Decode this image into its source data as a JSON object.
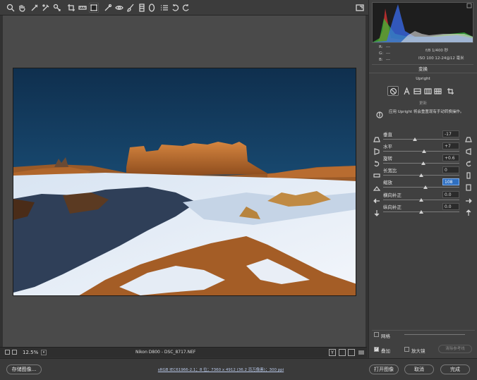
{
  "toolbar": {
    "tools": [
      "zoom-tool",
      "hand-tool",
      "white-balance-tool",
      "color-sampler-tool",
      "targeted-adjustment-tool",
      "crop-tool",
      "straighten-tool",
      "transform-tool",
      "spot-removal-tool",
      "red-eye-tool",
      "adjustment-brush-tool",
      "graduated-filter-tool",
      "radial-filter-tool",
      "preferences",
      "rotate-ccw",
      "rotate-cw"
    ],
    "fullscreen": "fullscreen-toggle"
  },
  "photo": {
    "filename": "DSC_8717.NEF"
  },
  "status": {
    "zoom": "12.5%",
    "camera_file": "Nikon D800 - DSC_8717.NEF",
    "view_modes": [
      "Y"
    ]
  },
  "footer": {
    "save_label": "存储图像...",
    "info": "sRGB IEC61966-2.1；8 位；7360 x 4912 (36.2 百万像素)；300 ppi",
    "open_label": "打开图像",
    "cancel_label": "取消",
    "done_label": "完成"
  },
  "histogram": {
    "r_label": "R:",
    "g_label": "G:",
    "b_label": "B:",
    "r_val": "---",
    "g_val": "---",
    "b_val": "---",
    "aperture_shutter": "f/8  1/400 秒",
    "iso_lens": "ISO 100  12-24@12 毫米"
  },
  "panel": {
    "title": "变换",
    "upright_label": "Upright",
    "upright_buttons": [
      "off",
      "auto",
      "level",
      "vertical",
      "full",
      "guided"
    ],
    "reanalyze_label": "更新",
    "info_text": "应用 Upright 将会重置现有手动转换操作。",
    "sliders": [
      {
        "label": "垂直",
        "value": "-17",
        "pos": 0.42,
        "selected": false
      },
      {
        "label": "水平",
        "value": "+7",
        "pos": 0.54,
        "selected": false
      },
      {
        "label": "旋转",
        "value": "+0.6",
        "pos": 0.53,
        "selected": false
      },
      {
        "label": "长宽比",
        "value": "0",
        "pos": 0.5,
        "selected": false
      },
      {
        "label": "缩放",
        "value": "108",
        "pos": 0.56,
        "selected": true
      },
      {
        "label": "横向补正",
        "value": "0.0",
        "pos": 0.5,
        "selected": false
      },
      {
        "label": "纵向补正",
        "value": "0.0",
        "pos": 0.5,
        "selected": false
      }
    ],
    "grid_label": "网格",
    "overlay_label": "叠加",
    "loupe_label": "放大镜",
    "clear_guides_label": "清除参考线"
  },
  "colors": {
    "accent": "#2f6fc0",
    "panel_bg": "#404040",
    "canvas_bg": "#4a4a4a"
  }
}
